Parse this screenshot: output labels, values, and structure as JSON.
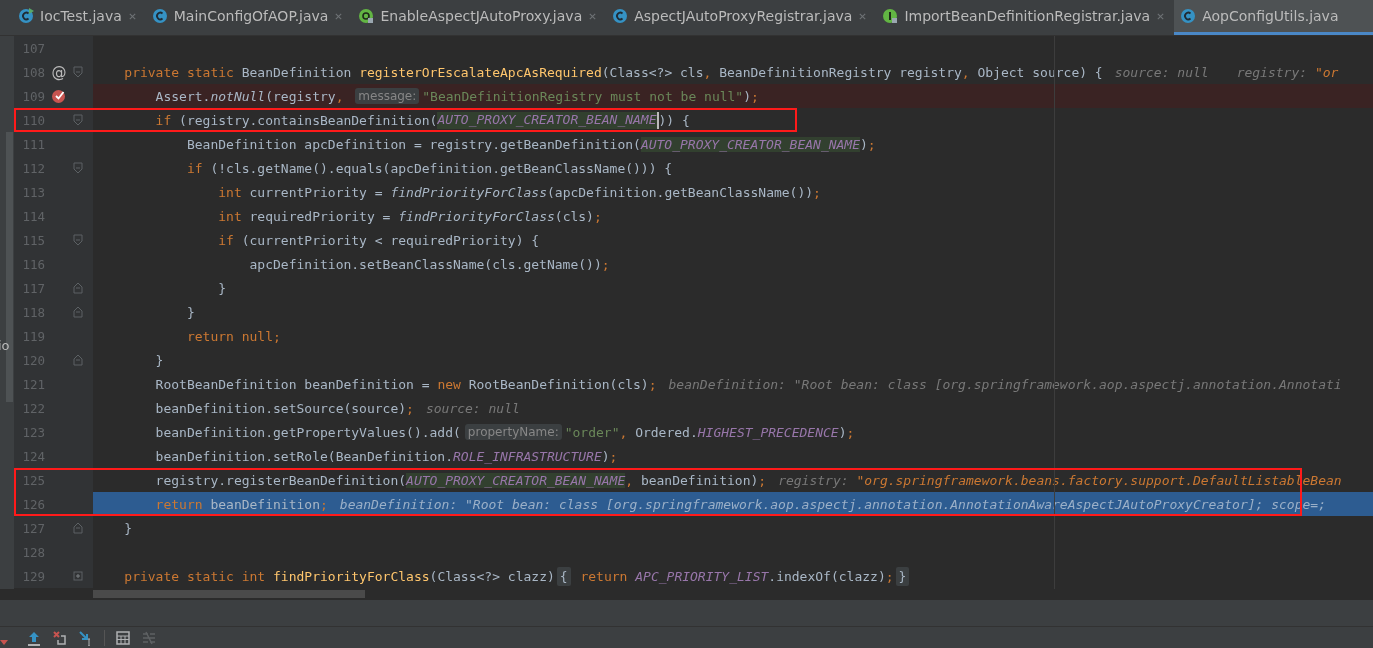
{
  "tabs": [
    {
      "label": "IocTest.java",
      "kind": "class",
      "runnable": true,
      "selected": false
    },
    {
      "label": "MainConfigOfAOP.java",
      "kind": "class",
      "runnable": false,
      "selected": false
    },
    {
      "label": "EnableAspectJAutoProxy.java",
      "kind": "annotation",
      "runnable": false,
      "selected": false
    },
    {
      "label": "AspectJAutoProxyRegistrar.java",
      "kind": "class",
      "runnable": false,
      "selected": false
    },
    {
      "label": "ImportBeanDefinitionRegistrar.java",
      "kind": "interface",
      "runnable": false,
      "selected": false
    },
    {
      "label": "AopConfigUtils.java",
      "kind": "class",
      "runnable": false,
      "selected": true
    }
  ],
  "left_panel": {
    "text": "io"
  },
  "lines": [
    {
      "number": "107",
      "kind": "normal",
      "marked": false
    },
    {
      "number": "108",
      "kind": "normal",
      "marked": false,
      "gutter_text": "@",
      "fold": {
        "kind": "start"
      },
      "tokens": [
        {
          "kind": "kw",
          "text": "    private static "
        },
        {
          "kind": "plain",
          "text": "BeanDefinition "
        },
        {
          "kind": "fn",
          "text": "registerOrEscalateApcAsRequired"
        },
        {
          "kind": "plain",
          "text": "(Class<?> cls"
        },
        {
          "kind": "punct",
          "text": ", "
        },
        {
          "kind": "plain",
          "text": "BeanDefinitionRegistry registry"
        },
        {
          "kind": "punct",
          "text": ", "
        },
        {
          "kind": "plain",
          "text": "Object source) {"
        },
        {
          "kind": "hint",
          "text": "source: null"
        },
        {
          "kind": "hint",
          "text": "registry: "
        },
        {
          "kind": "hint_str",
          "text": "\"or"
        }
      ]
    },
    {
      "number": "109",
      "kind": "breakpoint",
      "marked": false,
      "breakpoint": true,
      "tokens": [
        {
          "kind": "plain",
          "text": "        Assert."
        },
        {
          "kind": "italic",
          "text": "notNull"
        },
        {
          "kind": "plain",
          "text": "(registry"
        },
        {
          "kind": "punct",
          "text": ", "
        },
        {
          "kind": "param",
          "text": "message:"
        },
        {
          "kind": "str",
          "text": "\"BeanDefinitionRegistry must not be null\""
        },
        {
          "kind": "plain",
          "text": ")"
        },
        {
          "kind": "punct",
          "text": ";"
        }
      ]
    },
    {
      "number": "110",
      "kind": "normal",
      "marked": true,
      "fold": {
        "kind": "start"
      },
      "tokens": [
        {
          "kind": "kw",
          "text": "        if "
        },
        {
          "kind": "plain",
          "text": "(registry.containsBeanDefinition("
        },
        {
          "kind": "const_hl",
          "text": "AUTO_PROXY_CREATOR_BEAN_NAME",
          "caret": true
        },
        {
          "kind": "plain",
          "text": ")) {"
        }
      ]
    },
    {
      "number": "111",
      "kind": "normal",
      "marked": false,
      "tokens": [
        {
          "kind": "plain",
          "text": "            BeanDefinition apcDefinition = registry.getBeanDefinition("
        },
        {
          "kind": "const_hl",
          "text": "AUTO_PROXY_CREATOR_BEAN_NAME"
        },
        {
          "kind": "plain",
          "text": ")"
        },
        {
          "kind": "punct",
          "text": ";"
        }
      ]
    },
    {
      "number": "112",
      "kind": "normal",
      "marked": false,
      "fold": {
        "kind": "start"
      },
      "tokens": [
        {
          "kind": "kw",
          "text": "            if "
        },
        {
          "kind": "plain",
          "text": "(!cls.getName().equals(apcDefinition.getBeanClassName())) {"
        }
      ]
    },
    {
      "number": "113",
      "kind": "normal",
      "marked": false,
      "tokens": [
        {
          "kind": "kw",
          "text": "                int "
        },
        {
          "kind": "plain",
          "text": "currentPriority = "
        },
        {
          "kind": "italic",
          "text": "findPriorityForClass"
        },
        {
          "kind": "plain",
          "text": "(apcDefinition.getBeanClassName())"
        },
        {
          "kind": "punct",
          "text": ";"
        }
      ]
    },
    {
      "number": "114",
      "kind": "normal",
      "marked": false,
      "tokens": [
        {
          "kind": "kw",
          "text": "                int "
        },
        {
          "kind": "plain",
          "text": "requiredPriority = "
        },
        {
          "kind": "italic",
          "text": "findPriorityForClass"
        },
        {
          "kind": "plain",
          "text": "(cls)"
        },
        {
          "kind": "punct",
          "text": ";"
        }
      ]
    },
    {
      "number": "115",
      "kind": "normal",
      "marked": false,
      "fold": {
        "kind": "start"
      },
      "tokens": [
        {
          "kind": "kw",
          "text": "                if "
        },
        {
          "kind": "plain",
          "text": "(currentPriority < requiredPriority) {"
        }
      ]
    },
    {
      "number": "116",
      "kind": "normal",
      "marked": false,
      "tokens": [
        {
          "kind": "plain",
          "text": "                    apcDefinition.setBeanClassName(cls.getName())"
        },
        {
          "kind": "punct",
          "text": ";"
        }
      ]
    },
    {
      "number": "117",
      "kind": "normal",
      "marked": false,
      "fold": {
        "kind": "end"
      },
      "tokens": [
        {
          "kind": "plain",
          "text": "                }"
        }
      ]
    },
    {
      "number": "118",
      "kind": "normal",
      "marked": false,
      "fold": {
        "kind": "end"
      },
      "tokens": [
        {
          "kind": "plain",
          "text": "            }"
        }
      ]
    },
    {
      "number": "119",
      "kind": "normal",
      "marked": false,
      "tokens": [
        {
          "kind": "kw",
          "text": "            return null"
        },
        {
          "kind": "punct",
          "text": ";"
        }
      ]
    },
    {
      "number": "120",
      "kind": "normal",
      "marked": false,
      "fold": {
        "kind": "end"
      },
      "tokens": [
        {
          "kind": "plain",
          "text": "        }"
        }
      ]
    },
    {
      "number": "121",
      "kind": "normal",
      "marked": false,
      "tokens": [
        {
          "kind": "plain",
          "text": "        RootBeanDefinition beanDefinition = "
        },
        {
          "kind": "kw",
          "text": "new "
        },
        {
          "kind": "plain",
          "text": "RootBeanDefinition(cls)"
        },
        {
          "kind": "punct",
          "text": ";"
        },
        {
          "kind": "hint",
          "text": "beanDefinition: \"Root bean: class [org.springframework.aop.aspectj.annotation.Annotati"
        }
      ]
    },
    {
      "number": "122",
      "kind": "normal",
      "marked": false,
      "tokens": [
        {
          "kind": "plain",
          "text": "        beanDefinition.setSource(source)"
        },
        {
          "kind": "punct",
          "text": ";"
        },
        {
          "kind": "hint",
          "text": "source: null"
        }
      ]
    },
    {
      "number": "123",
      "kind": "normal",
      "marked": false,
      "tokens": [
        {
          "kind": "plain",
          "text": "        beanDefinition.getPropertyValues().add("
        },
        {
          "kind": "param",
          "text": "propertyName:"
        },
        {
          "kind": "str",
          "text": "\"order\""
        },
        {
          "kind": "punct",
          "text": ", "
        },
        {
          "kind": "plain",
          "text": "Ordered."
        },
        {
          "kind": "const",
          "text": "HIGHEST_PRECEDENCE"
        },
        {
          "kind": "plain",
          "text": ")"
        },
        {
          "kind": "punct",
          "text": ";"
        }
      ]
    },
    {
      "number": "124",
      "kind": "normal",
      "marked": false,
      "tokens": [
        {
          "kind": "plain",
          "text": "        beanDefinition.setRole(BeanDefinition."
        },
        {
          "kind": "const",
          "text": "ROLE_INFRASTRUCTURE"
        },
        {
          "kind": "plain",
          "text": ")"
        },
        {
          "kind": "punct",
          "text": ";"
        }
      ]
    },
    {
      "number": "125",
      "kind": "normal",
      "marked": true,
      "tokens": [
        {
          "kind": "plain",
          "text": "        registry.registerBeanDefinition("
        },
        {
          "kind": "const_hl",
          "text": "AUTO_PROXY_CREATOR_BEAN_NAME"
        },
        {
          "kind": "punct",
          "text": ", "
        },
        {
          "kind": "plain",
          "text": "beanDefinition)"
        },
        {
          "kind": "punct",
          "text": ";"
        },
        {
          "kind": "hint",
          "text": "registry: "
        },
        {
          "kind": "hint_str",
          "text": "\"org.springframework.beans.factory.support.DefaultListableBean"
        }
      ]
    },
    {
      "number": "126",
      "kind": "current",
      "marked": true,
      "tokens": [
        {
          "kind": "kw",
          "text": "        return "
        },
        {
          "kind": "plain",
          "text": "beanDefinition"
        },
        {
          "kind": "punct",
          "text": ";"
        },
        {
          "kind": "hint",
          "text": "beanDefinition: \"Root bean: class [org.springframework.aop.aspectj.annotation.AnnotationAwareAspectJAutoProxyCreator]; scope=;"
        }
      ]
    },
    {
      "number": "127",
      "kind": "normal",
      "marked": false,
      "fold": {
        "kind": "end"
      },
      "tokens": [
        {
          "kind": "plain",
          "text": "    }"
        }
      ]
    },
    {
      "number": "128",
      "kind": "normal",
      "marked": false
    },
    {
      "number": "129",
      "kind": "normal",
      "marked": false,
      "fold": {
        "kind": "collapsed"
      },
      "tokens": [
        {
          "kind": "kw",
          "text": "    private static int "
        },
        {
          "kind": "fn",
          "text": "findPriorityForClass"
        },
        {
          "kind": "plain",
          "text": "(Class<?> clazz)"
        },
        {
          "kind": "fold_brace",
          "text": "{"
        },
        {
          "kind": "kw",
          "text": " return "
        },
        {
          "kind": "const",
          "text": "APC_PRIORITY_LIST"
        },
        {
          "kind": "plain",
          "text": ".indexOf(clazz)"
        },
        {
          "kind": "punct",
          "text": ";"
        },
        {
          "kind": "fold_brace",
          "text": "}"
        }
      ]
    }
  ]
}
